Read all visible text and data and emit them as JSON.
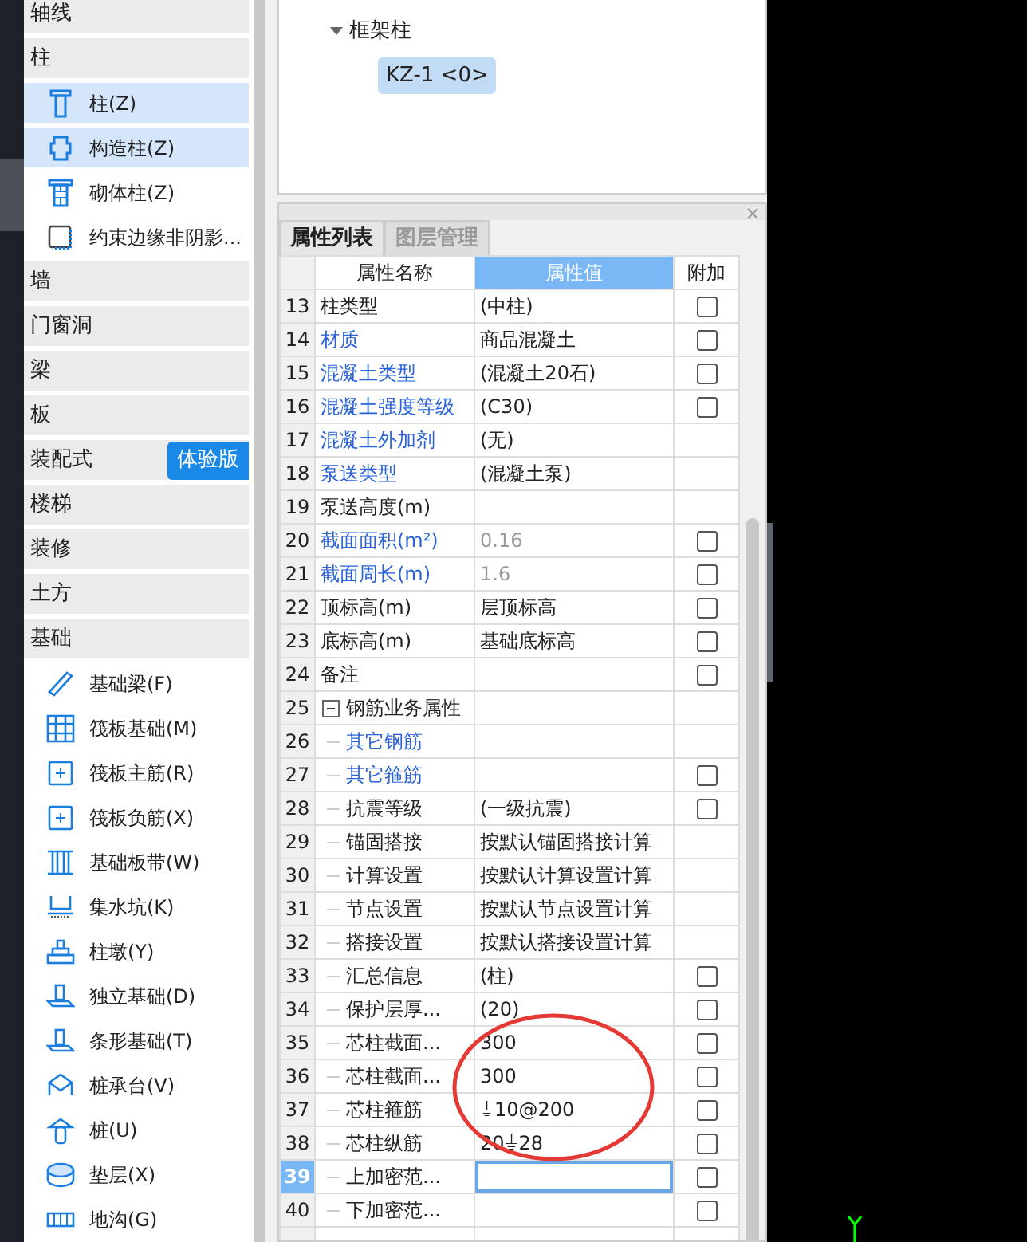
{
  "sidebar": {
    "items": [
      {
        "kind": "group",
        "label": "轴线"
      },
      {
        "kind": "group",
        "label": "柱"
      },
      {
        "kind": "item",
        "label": "柱(Z)",
        "selected": true
      },
      {
        "kind": "item",
        "label": "构造柱(Z)",
        "selected": true
      },
      {
        "kind": "item",
        "label": "砌体柱(Z)",
        "selected": false
      },
      {
        "kind": "item",
        "label": "约束边缘非阴影...",
        "selected": false
      },
      {
        "kind": "group",
        "label": "墙"
      },
      {
        "kind": "group",
        "label": "门窗洞"
      },
      {
        "kind": "group",
        "label": "梁"
      },
      {
        "kind": "group",
        "label": "板"
      },
      {
        "kind": "group",
        "label": "装配式",
        "badge": "体验版"
      },
      {
        "kind": "group",
        "label": "楼梯"
      },
      {
        "kind": "group",
        "label": "装修"
      },
      {
        "kind": "group",
        "label": "土方"
      },
      {
        "kind": "group",
        "label": "基础"
      },
      {
        "kind": "item",
        "label": "基础梁(F)",
        "selected": false
      },
      {
        "kind": "item",
        "label": "筏板基础(M)",
        "selected": false
      },
      {
        "kind": "item",
        "label": "筏板主筋(R)",
        "selected": false
      },
      {
        "kind": "item",
        "label": "筏板负筋(X)",
        "selected": false
      },
      {
        "kind": "item",
        "label": "基础板带(W)",
        "selected": false
      },
      {
        "kind": "item",
        "label": "集水坑(K)",
        "selected": false
      },
      {
        "kind": "item",
        "label": "柱墩(Y)",
        "selected": false
      },
      {
        "kind": "item",
        "label": "独立基础(D)",
        "selected": false
      },
      {
        "kind": "item",
        "label": "条形基础(T)",
        "selected": false
      },
      {
        "kind": "item",
        "label": "桩承台(V)",
        "selected": false
      },
      {
        "kind": "item",
        "label": "桩(U)",
        "selected": false
      },
      {
        "kind": "item",
        "label": "垫层(X)",
        "selected": false
      },
      {
        "kind": "item",
        "label": "地沟(G)",
        "selected": false
      }
    ]
  },
  "tree": {
    "label": "框架柱",
    "expanded": true,
    "children": [
      {
        "label": "KZ-1 <0>",
        "selected": true
      }
    ]
  },
  "tabs": [
    {
      "label": "属性列表",
      "selected": true
    },
    {
      "label": "图层管理",
      "selected": false
    }
  ],
  "table": {
    "columns": [
      {
        "label": "属性名称",
        "selected": false
      },
      {
        "label": "属性值",
        "selected": true
      },
      {
        "label": "附加",
        "selected": false
      }
    ],
    "rows": [
      {
        "num": "13",
        "name": "柱类型",
        "linked": false,
        "value": "(中柱)",
        "readonly": false,
        "attached": false
      },
      {
        "num": "14",
        "name": "材质",
        "linked": true,
        "value": "商品混凝土",
        "readonly": false,
        "attached": false
      },
      {
        "num": "15",
        "name": "混凝土类型",
        "linked": true,
        "value": "(混凝土20石)",
        "readonly": false,
        "attached": false
      },
      {
        "num": "16",
        "name": "混凝土强度等级",
        "linked": true,
        "value": "(C30)",
        "readonly": false,
        "attached": false
      },
      {
        "num": "17",
        "name": "混凝土外加剂",
        "linked": true,
        "value": "(无)",
        "readonly": false
      },
      {
        "num": "18",
        "name": "泵送类型",
        "linked": true,
        "value": "(混凝土泵)",
        "readonly": false
      },
      {
        "num": "19",
        "name": "泵送高度(m)",
        "linked": false,
        "readonly": false
      },
      {
        "num": "20",
        "name": "截面面积(m²)",
        "linked": true,
        "value": "0.16",
        "readonly": true,
        "attached": false
      },
      {
        "num": "21",
        "name": "截面周长(m)",
        "linked": true,
        "value": "1.6",
        "readonly": true,
        "attached": false
      },
      {
        "num": "22",
        "name": "顶标高(m)",
        "linked": false,
        "value": "层顶标高",
        "readonly": false,
        "attached": false
      },
      {
        "num": "23",
        "name": "底标高(m)",
        "linked": false,
        "value": "基础底标高",
        "readonly": false,
        "attached": false
      },
      {
        "num": "24",
        "name": "备注",
        "linked": false,
        "readonly": false,
        "attached": false
      },
      {
        "num": "25",
        "name": "钢筋业务属性",
        "linked": false,
        "readonly": false,
        "expanded": true,
        "children": [
          {
            "num": "26",
            "name": "其它钢筋",
            "linked": true,
            "readonly": false
          },
          {
            "num": "27",
            "name": "其它箍筋",
            "linked": true,
            "readonly": false,
            "attached": false
          },
          {
            "num": "28",
            "name": "抗震等级",
            "linked": false,
            "value": "(一级抗震)",
            "readonly": false,
            "attached": false
          },
          {
            "num": "29",
            "name": "锚固搭接",
            "linked": false,
            "value": "按默认锚固搭接计算",
            "readonly": false
          },
          {
            "num": "30",
            "name": "计算设置",
            "linked": false,
            "value": "按默认计算设置计算",
            "readonly": false
          },
          {
            "num": "31",
            "name": "节点设置",
            "linked": false,
            "value": "按默认节点设置计算",
            "readonly": false
          },
          {
            "num": "32",
            "name": "搭接设置",
            "linked": false,
            "value": "按默认搭接设置计算",
            "readonly": false
          },
          {
            "num": "33",
            "name": "汇总信息",
            "linked": false,
            "value": "(柱)",
            "readonly": false,
            "attached": false
          },
          {
            "num": "34",
            "name": "保护层厚...",
            "linked": false,
            "value": "(20)",
            "readonly": false,
            "attached": false
          },
          {
            "num": "35",
            "name": "芯柱截面...",
            "linked": false,
            "value": "300",
            "readonly": false,
            "attached": false
          },
          {
            "num": "36",
            "name": "芯柱截面...",
            "linked": false,
            "value": "300",
            "readonly": false,
            "attached": false
          },
          {
            "num": "37",
            "name": "芯柱箍筋",
            "linked": false,
            "value": "⏚10@200",
            "readonly": false,
            "attached": false
          },
          {
            "num": "38",
            "name": "芯柱纵筋",
            "linked": false,
            "value": "20⏚28",
            "readonly": false,
            "attached": false
          },
          {
            "num": "39",
            "name": "上加密范...",
            "linked": false,
            "readonly": false,
            "attached": false,
            "selected": true
          },
          {
            "num": "40",
            "name": "下加密范...",
            "linked": false,
            "readonly": false,
            "attached": false
          }
        ]
      }
    ]
  }
}
